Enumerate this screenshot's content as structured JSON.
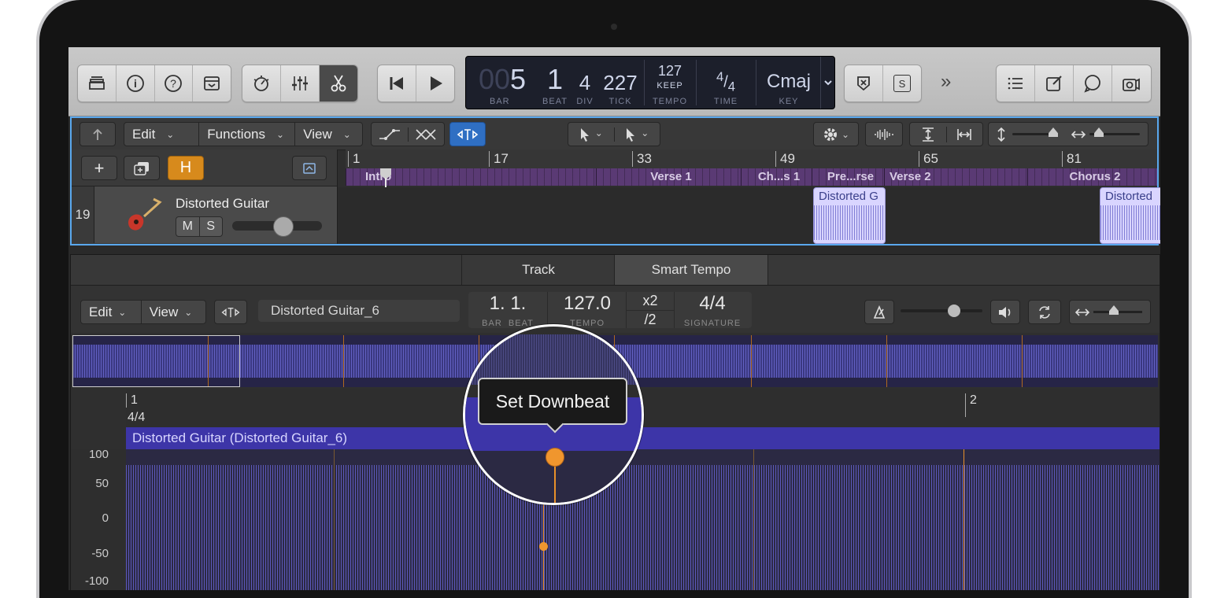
{
  "lcd": {
    "bar_dim": "00",
    "bar": "5",
    "beat": "1",
    "div": "4",
    "tick": "227",
    "tempo": "127",
    "tempo_mode": "KEEP",
    "time_num": "4",
    "time_den": "4",
    "key": "Cmaj",
    "labels": {
      "bar": "BAR",
      "beat": "BEAT",
      "div": "DIV",
      "tick": "TICK",
      "tempo": "TEMPO",
      "time": "TIME",
      "key": "KEY"
    }
  },
  "toolbar": {
    "library_icon": "library-icon",
    "info_icon": "info-icon",
    "help_icon": "help-icon",
    "toolbar_icon": "toolbar-icon",
    "smart_controls_icon": "smart-controls-icon",
    "mixer_icon": "mixer-icon",
    "editors_icon": "scissors-icon",
    "rewind_icon": "rewind-icon",
    "play_icon": "play-icon",
    "count_in_icon": "count-in-icon",
    "solo_label": "S",
    "more": "»"
  },
  "tracks_bar": {
    "edit": "Edit",
    "functions": "Functions",
    "view": "View"
  },
  "track_header": {
    "add": "+",
    "h": "H",
    "number": "19",
    "name": "Distorted Guitar",
    "mute": "M",
    "solo": "S"
  },
  "ruler": [
    "1",
    "17",
    "33",
    "49",
    "65",
    "81"
  ],
  "arrangement": [
    "Intro",
    "Verse 1",
    "Ch...s 1",
    "Pre...rse",
    "Verse 2",
    "Chorus 2"
  ],
  "regions": [
    "Distorted G",
    "Distorted"
  ],
  "editor": {
    "tabs": [
      "Track",
      "Smart Tempo"
    ],
    "edit": "Edit",
    "view": "View",
    "file": "Distorted Guitar_6",
    "position": "1. 1.",
    "bar_label": "BAR",
    "beat_label": "BEAT",
    "tempo": "127.0",
    "tempo_label": "TEMPO",
    "x2": "x2",
    "div2": "/2",
    "signature": "4/4",
    "signature_label": "SIGNATURE",
    "ruler_1": "1",
    "ruler_sig": "4/4",
    "ruler_2": "2",
    "region_name": "Distorted Guitar (Distorted Guitar_6)",
    "y_labels": [
      "100",
      "50",
      "0",
      "-50",
      "-100"
    ]
  },
  "tooltip": "Set Downbeat",
  "colors": {
    "accent": "#5aa8ee",
    "downbeat": "#f0962e",
    "region": "#3d35a8"
  }
}
